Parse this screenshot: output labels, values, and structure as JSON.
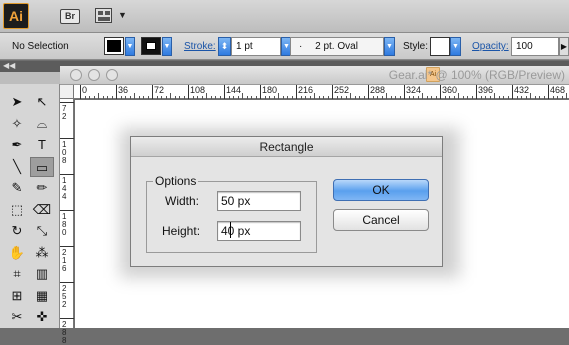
{
  "app": {
    "logo": "Ai",
    "bridge": "Br",
    "arrange_caret": "▼"
  },
  "control_bar": {
    "selection": "No Selection",
    "stroke_label": "Stroke:",
    "stroke_value": "1 pt",
    "brush_dot": "·",
    "brush_value": "2 pt. Oval",
    "style_label": "Style:",
    "opacity_label": "Opacity:",
    "opacity_value": "100",
    "dropdown_caret": "▼",
    "stepper": "⬍"
  },
  "panel_collapse": "◀◀",
  "document": {
    "ai_badge": "Ai",
    "title": "Gear.ai* @ 100% (RGB/Preview)",
    "ruler_h": [
      "0",
      "36",
      "72",
      "108",
      "144",
      "180",
      "216",
      "252",
      "288",
      "324",
      "360",
      "396",
      "432",
      "468"
    ],
    "ruler_v": [
      "7\n2",
      "1\n0\n8",
      "1\n4\n4",
      "1\n8\n0",
      "2\n1\n6",
      "2\n5\n2",
      "2\n8\n8"
    ]
  },
  "tools": [
    [
      "➤",
      "↖"
    ],
    [
      "✧",
      "⌓"
    ],
    [
      "✒",
      "T"
    ],
    [
      "╲",
      "▭"
    ],
    [
      "✎",
      "✏"
    ],
    [
      "⬚",
      "⌫"
    ],
    [
      "↻",
      "⤡"
    ],
    [
      "✋",
      "⁂"
    ],
    [
      "⌗",
      "▥"
    ],
    [
      "⊞",
      "▦"
    ],
    [
      "✂",
      "✜"
    ]
  ],
  "tool_names": [
    [
      "selection-tool-icon",
      "direct-selection-tool-icon"
    ],
    [
      "magic-wand-icon",
      "lasso-icon"
    ],
    [
      "pen-tool-icon",
      "type-tool-icon"
    ],
    [
      "line-tool-icon",
      "rectangle-tool-icon"
    ],
    [
      "paintbrush-icon",
      "pencil-icon"
    ],
    [
      "blob-brush-icon",
      "eraser-icon"
    ],
    [
      "rotate-tool-icon",
      "scale-tool-icon"
    ],
    [
      "warp-tool-icon",
      "free-transform-icon"
    ],
    [
      "symbol-sprayer-icon",
      "graph-tool-icon"
    ],
    [
      "mesh-tool-icon",
      "gradient-tool-icon"
    ],
    [
      "eyedropper-icon",
      "blend-tool-icon"
    ]
  ],
  "dialog": {
    "title": "Rectangle",
    "options_legend": "Options",
    "width_label": "Width:",
    "width_value": "50 px",
    "height_label": "Height:",
    "height_value": "40 px",
    "ok_label": "OK",
    "cancel_label": "Cancel"
  },
  "colors": {
    "accent_blue": "#5aa0ee",
    "ai_orange": "#f0a23a"
  }
}
